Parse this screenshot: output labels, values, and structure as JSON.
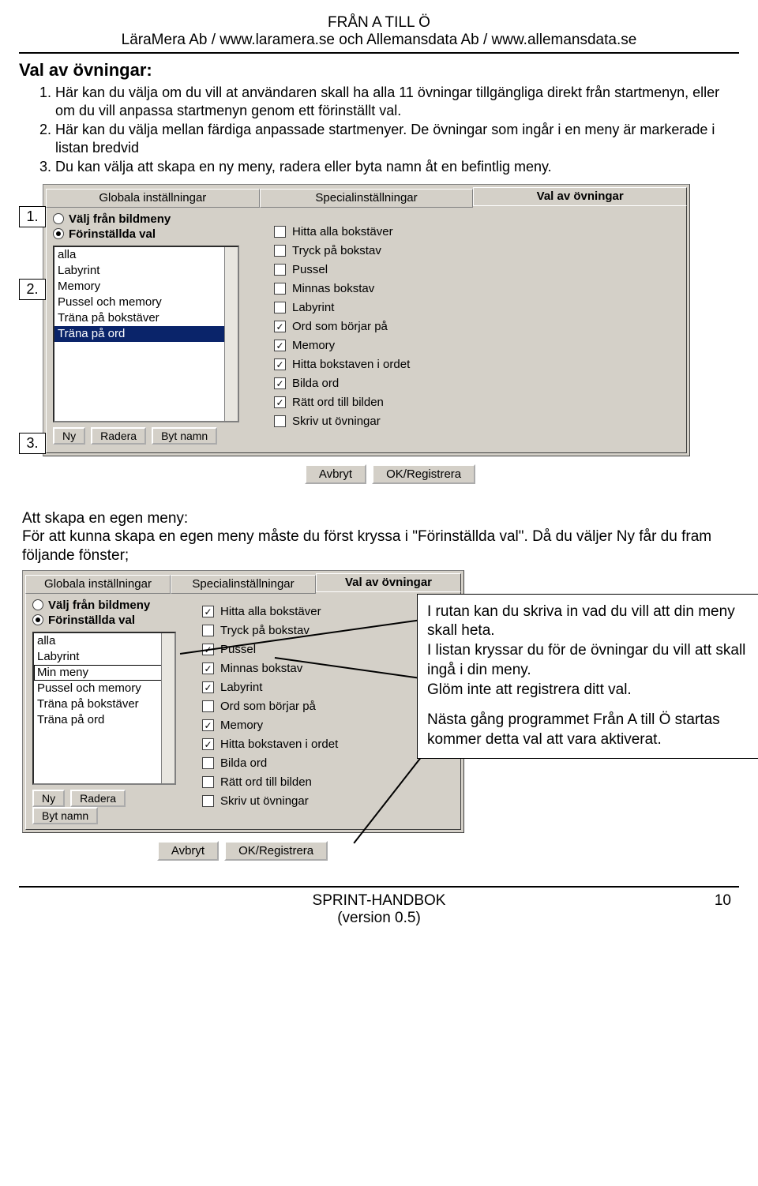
{
  "header": {
    "line1": "FRÅN A TILL Ö",
    "line2": "LäraMera Ab / www.laramera.se och Allemansdata Ab / www.allemansdata.se"
  },
  "heading": "Val av övningar:",
  "list": [
    "Här kan du välja om du vill at användaren skall ha alla 11 övningar tillgängliga direkt från startmenyn, eller om du vill anpassa startmenyn genom ett förinställt val.",
    "Här kan du välja mellan färdiga anpassade startmenyer. De övningar som ingår i en meny är markerade i listan bredvid",
    "Du kan välja att skapa en ny meny, radera eller byta namn åt en befintlig meny."
  ],
  "fig_labels": {
    "l1": "1.",
    "l2": "2.",
    "l3": "3."
  },
  "dialog": {
    "tabs": [
      "Globala inställningar",
      "Specialinställningar",
      "Val av övningar"
    ],
    "radio1": "Välj från bildmeny",
    "radio2": "Förinställda val",
    "buttons": {
      "ny": "Ny",
      "radera": "Radera",
      "byt": "Byt namn"
    },
    "footer_cancel": "Avbryt",
    "footer_ok": "OK/Registrera"
  },
  "list1_items": [
    "alla",
    "Labyrint",
    "Memory",
    "Pussel och memory",
    "Träna på bokstäver",
    "Träna på ord"
  ],
  "list1_selected_index": 5,
  "checks1": [
    {
      "label": "Hitta alla bokstäver",
      "on": false
    },
    {
      "label": "Tryck på bokstav",
      "on": false
    },
    {
      "label": "Pussel",
      "on": false
    },
    {
      "label": "Minnas bokstav",
      "on": false
    },
    {
      "label": "Labyrint",
      "on": false
    },
    {
      "label": "Ord som börjar på",
      "on": true
    },
    {
      "label": "Memory",
      "on": true
    },
    {
      "label": "Hitta bokstaven i ordet",
      "on": true
    },
    {
      "label": "Bilda ord",
      "on": true
    },
    {
      "label": "Rätt ord till bilden",
      "on": true
    },
    {
      "label": "Skriv ut övningar",
      "on": false
    }
  ],
  "mid_para_head": "Att skapa en egen meny:",
  "mid_para_body": "För att kunna skapa en egen meny måste du först kryssa i \"Förinställda val\". Då du väljer Ny får du fram följande fönster;",
  "list2_items": [
    "alla",
    "Labyrint",
    "Min meny",
    "Pussel och memory",
    "Träna på bokstäver",
    "Träna på ord"
  ],
  "list2_edit_index": 2,
  "checks2": [
    {
      "label": "Hitta alla bokstäver",
      "on": true
    },
    {
      "label": "Tryck på bokstav",
      "on": false
    },
    {
      "label": "Pussel",
      "on": true
    },
    {
      "label": "Minnas bokstav",
      "on": true
    },
    {
      "label": "Labyrint",
      "on": true
    },
    {
      "label": "Ord som börjar på",
      "on": false
    },
    {
      "label": "Memory",
      "on": true
    },
    {
      "label": "Hitta bokstaven i ordet",
      "on": true
    },
    {
      "label": "Bilda ord",
      "on": false
    },
    {
      "label": "Rätt ord till bilden",
      "on": false
    },
    {
      "label": "Skriv ut övningar",
      "on": false
    }
  ],
  "annotation": {
    "p1": "I rutan kan du skriva in vad du vill att din meny skall heta.",
    "p2": "I listan kryssar du för de övningar du vill att skall ingå i din meny.",
    "p3": "Glöm inte att registrera ditt val.",
    "p4": "Nästa gång programmet Från A till Ö startas kommer detta val att vara aktiverat."
  },
  "footer": {
    "title": "SPRINT-HANDBOK",
    "version": "(version 0.5)",
    "page": "10"
  }
}
